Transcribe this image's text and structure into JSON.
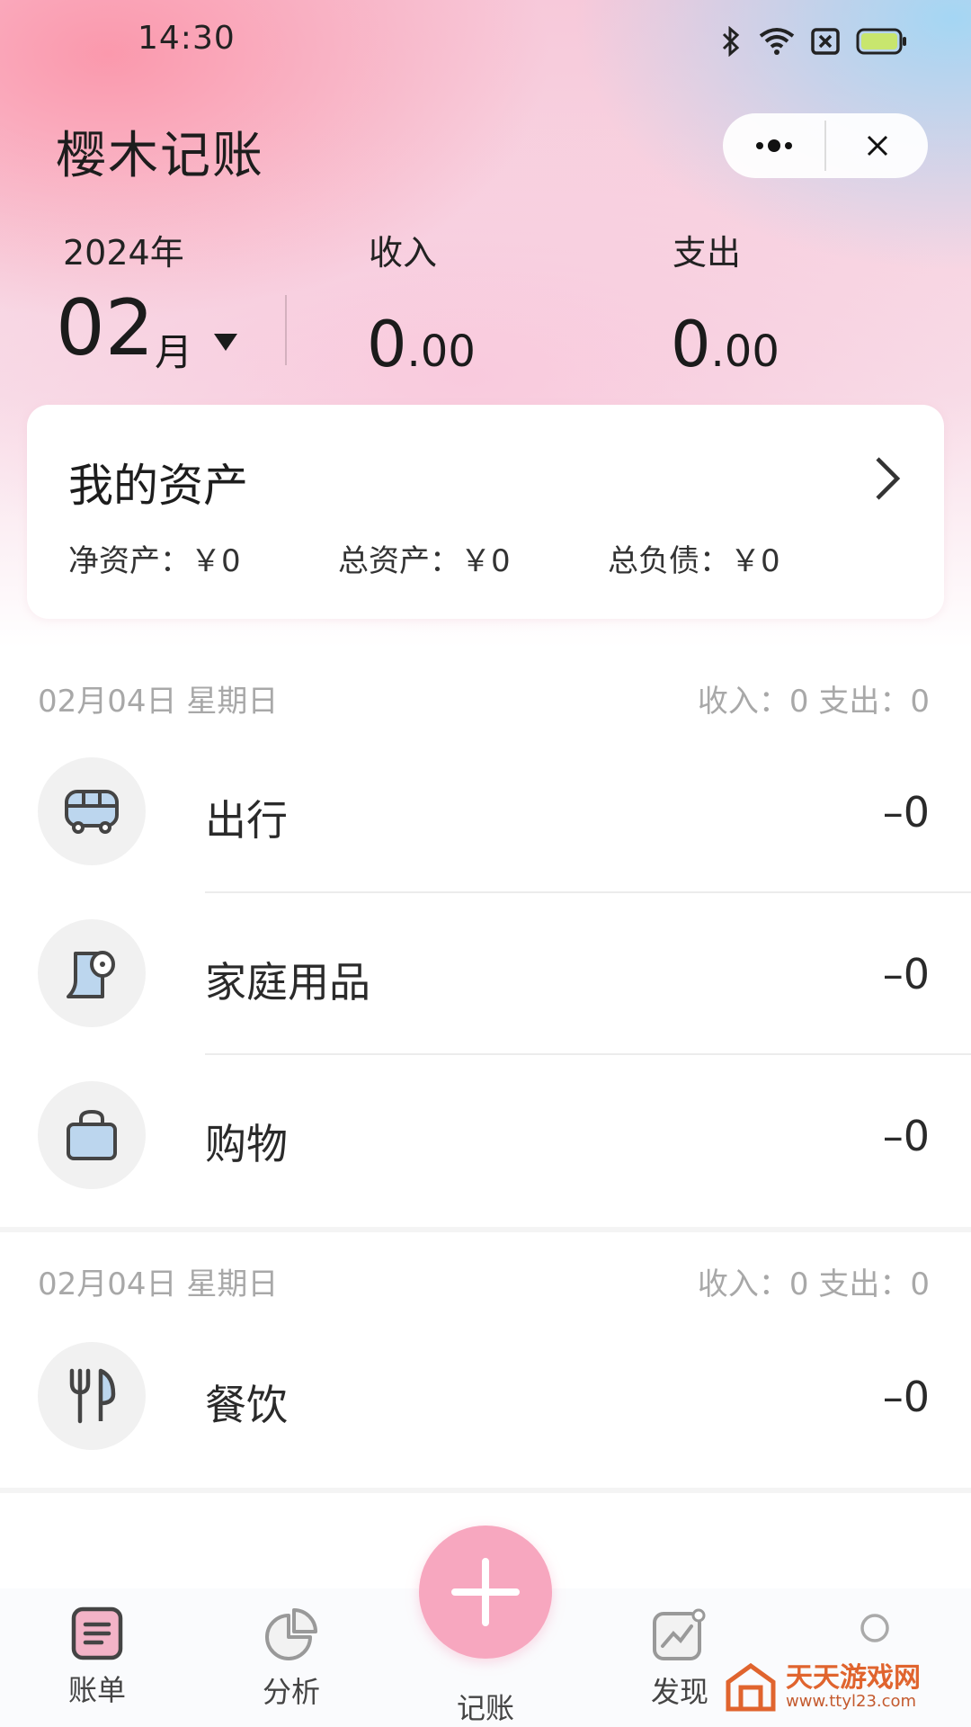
{
  "status_bar": {
    "time": "14:30"
  },
  "header": {
    "app_title": "樱木记账",
    "year_label": "2024年",
    "month_number": "02",
    "month_unit": "月",
    "income_label": "收入",
    "income_int": "0",
    "income_dec": ".00",
    "expense_label": "支出",
    "expense_int": "0",
    "expense_dec": ".00"
  },
  "assets": {
    "title": "我的资产",
    "net_assets": "净资产：￥0",
    "total_assets": "总资产：￥0",
    "total_liabilities": "总负债：￥0"
  },
  "groups": [
    {
      "date": "02月04日  星期日",
      "summary": "收入：0    支出：0",
      "items": [
        {
          "label": "出行",
          "amount": "–0",
          "icon": "bus-icon"
        },
        {
          "label": "家庭用品",
          "amount": "–0",
          "icon": "toilet-paper-icon"
        },
        {
          "label": "购物",
          "amount": "–0",
          "icon": "shopping-bag-icon"
        }
      ]
    },
    {
      "date": "02月04日  星期日",
      "summary": "收入：0    支出：0",
      "items": [
        {
          "label": "餐饮",
          "amount": "–0",
          "icon": "cutlery-icon"
        }
      ]
    }
  ],
  "bottom_nav": {
    "bills": "账单",
    "analysis": "分析",
    "record": "记账",
    "discover": "发现"
  },
  "watermark": {
    "title": "天天游戏网",
    "url": "www.ttyl23.com"
  },
  "colors": {
    "accent": "#f7a7bf",
    "muted_text": "#a8a8a8",
    "icon_blue": "#bcd6ee"
  }
}
